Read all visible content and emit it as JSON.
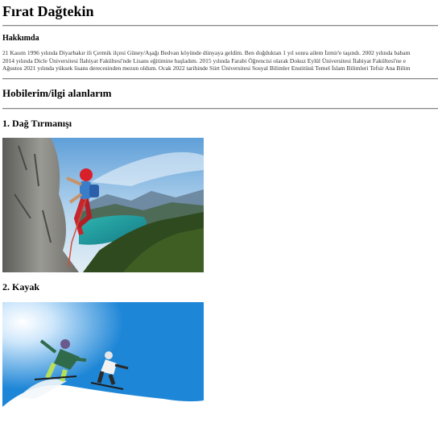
{
  "profile": {
    "name": "Fırat Dağtekin"
  },
  "about": {
    "heading": "Hakkımda",
    "lines": [
      "21 Kasım 1996 yılında Diyarbakır ili Çermik ilçesi Güney/Aşağı Bedvan köyünde dünyaya geldim. Ben doğduktan 1 yıl sonra ailem İzmir'e taşındı. 2002 yılında babam",
      "2014 yılında Dicle Üniversitesi İlahiyat Fakültesi'nde Lisans eğitimine başladım. 2015 yılında Farabi Öğrencisi olarak Dokuz Eylül Üniversitesi İlahiyat Fakültesi'ne e",
      "Ağustos 2021 yılında yüksek lisans derecesinden mezun oldum. Ocak 2022 tarihinde Siirt Üniversitesi Sosyal Bilimler Enstitüsü Temel İslam Bilimleri Tefsir Ana Bilim"
    ]
  },
  "hobbies": {
    "heading": "Hobilerim/ilgi alanlarım",
    "items": [
      {
        "title": "1. Dağ Tırmanışı",
        "image": "rock-climbing-photo"
      },
      {
        "title": "2. Kayak",
        "image": "skiing-photo"
      }
    ]
  }
}
